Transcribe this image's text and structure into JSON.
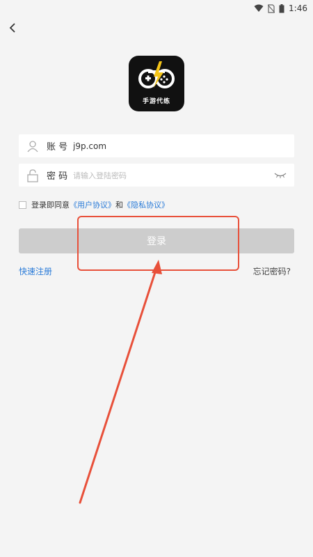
{
  "status_bar": {
    "time": "1:46"
  },
  "logo": {
    "text": "手游代练"
  },
  "account": {
    "label": "账 号",
    "value": "j9p.com"
  },
  "password": {
    "label": "密 码",
    "placeholder": "请输入登陆密码"
  },
  "agreement": {
    "prefix": "登录即同意",
    "user_agreement": "《用户协议》",
    "conjunction": "和",
    "privacy_agreement": "《隐私协议》"
  },
  "login_button": {
    "label": "登录"
  },
  "register_link": "快速注册",
  "forgot_link": "忘记密码?",
  "colors": {
    "link": "#2a7bd8",
    "annotation": "#e8503a",
    "button_disabled": "#cdcdcd"
  }
}
